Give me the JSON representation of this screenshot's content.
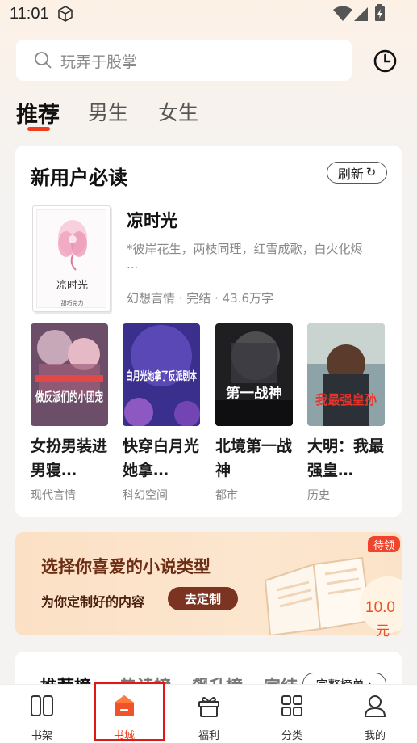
{
  "status_bar": {
    "time": "11:01"
  },
  "search": {
    "placeholder": "玩弄于股掌"
  },
  "tabs": [
    {
      "label": "推荐",
      "active": true
    },
    {
      "label": "男生",
      "active": false
    },
    {
      "label": "女生",
      "active": false
    }
  ],
  "new_user": {
    "title": "新用户必读",
    "refresh_label": "刷新",
    "featured": {
      "cover_title": "凉时光",
      "cover_author": "甜巧克力",
      "title": "凉时光",
      "description": "*彼岸花生，两枝同理，红雪成歌，白火化烬",
      "ellipsis": "...",
      "meta": "幻想言情 · 完结 · 43.6万字"
    },
    "books": [
      {
        "title": "女扮男装进男寝…",
        "category": "现代言情",
        "cover_text": "做反派们的小团宠"
      },
      {
        "title": "快穿白月光她拿…",
        "category": "科幻空间",
        "cover_text": "白月光她拿了反派剧本"
      },
      {
        "title": "北境第一战神",
        "category": "都市",
        "cover_text": "第一战神"
      },
      {
        "title": "大明：我最强皇…",
        "category": "历史",
        "cover_text": "我最强皇孙"
      }
    ]
  },
  "banner": {
    "title": "选择你喜爱的小说类型",
    "subtitle": "为你定制好的内容",
    "button_label": "去定制",
    "badge": "待领",
    "amount": "10.0",
    "unit": "元"
  },
  "ranking": {
    "tabs": [
      "推荐榜",
      "热读榜",
      "飙升榜",
      "完结"
    ],
    "more_label": "完整榜单 ›"
  },
  "bottom_nav": [
    {
      "label": "书架",
      "icon": "bookshelf-icon",
      "active": false
    },
    {
      "label": "书城",
      "icon": "store-icon",
      "active": true
    },
    {
      "label": "福利",
      "icon": "gift-icon",
      "active": false
    },
    {
      "label": "分类",
      "icon": "category-grid-icon",
      "active": false
    },
    {
      "label": "我的",
      "icon": "profile-icon",
      "active": false
    }
  ],
  "colors": {
    "accent": "#f23c1e",
    "highlight_box": "#e01818",
    "banner_button": "#7b3322"
  }
}
